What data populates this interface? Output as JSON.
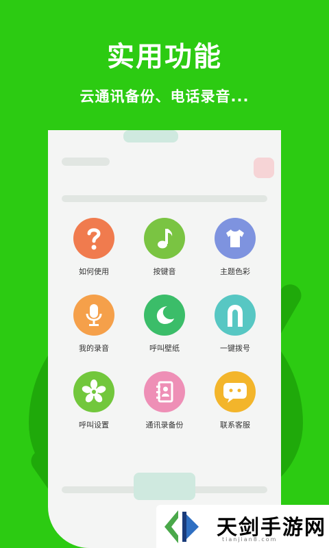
{
  "header": {
    "title": "实用功能",
    "subtitle": "云通讯备份、电话录音..."
  },
  "features": [
    {
      "label": "如何使用",
      "icon": "question-icon",
      "color": "#f07b4e"
    },
    {
      "label": "按键音",
      "icon": "music-note-icon",
      "color": "#7ac442"
    },
    {
      "label": "主题色彩",
      "icon": "tshirt-icon",
      "color": "#7e93df"
    },
    {
      "label": "我的录音",
      "icon": "microphone-icon",
      "color": "#f5a04a"
    },
    {
      "label": "呼叫壁纸",
      "icon": "moon-icon",
      "color": "#3bbd69"
    },
    {
      "label": "一键拨号",
      "icon": "arch-icon",
      "color": "#57c7c3"
    },
    {
      "label": "呼叫设置",
      "icon": "asterisk-icon",
      "color": "#72c73c"
    },
    {
      "label": "通讯录备份",
      "icon": "contacts-book-icon",
      "color": "#ee8fb6"
    },
    {
      "label": "联系客服",
      "icon": "chat-bubble-icon",
      "color": "#f3b52b"
    }
  ],
  "watermark": {
    "text": "天剑手游网",
    "subtext": "tianjian8.com"
  }
}
